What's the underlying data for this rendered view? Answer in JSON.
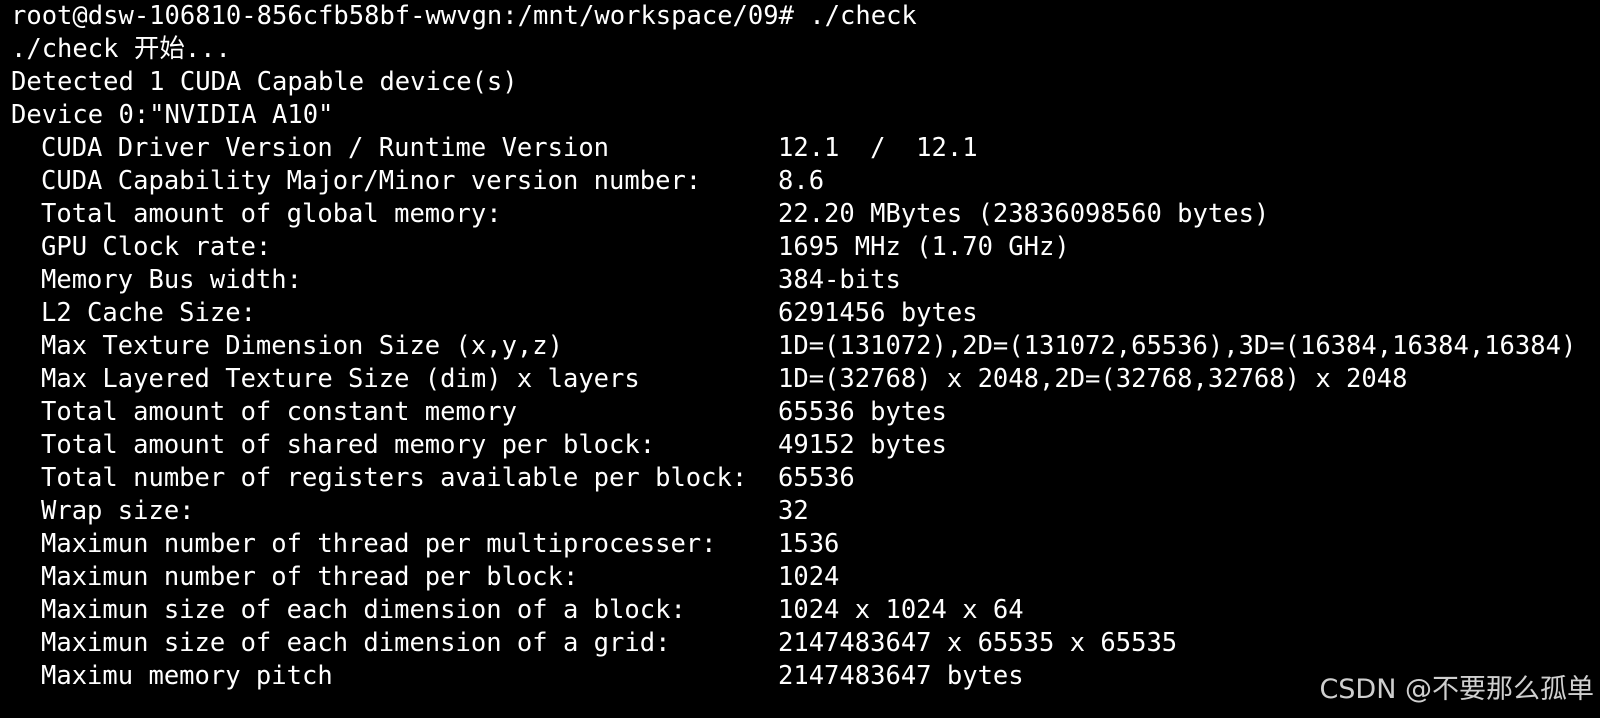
{
  "terminal": {
    "prompt_line": "root@dsw-106810-856cfb58bf-wwvgn:/mnt/workspace/09# ./check",
    "start_line": "./check 开始...",
    "detected_line": "Detected 1 CUDA Capable device(s)",
    "device_line": "Device 0:\"NVIDIA A10\"",
    "properties": [
      {
        "label": "CUDA Driver Version / Runtime Version",
        "value": "12.1  /  12.1"
      },
      {
        "label": "CUDA Capability Major/Minor version number:",
        "value": "8.6"
      },
      {
        "label": "Total amount of global memory:",
        "value": "22.20 MBytes (23836098560 bytes)"
      },
      {
        "label": "GPU Clock rate:",
        "value": "1695 MHz (1.70 GHz)"
      },
      {
        "label": "Memory Bus width:",
        "value": "384-bits"
      },
      {
        "label": "L2 Cache Size:",
        "value": "6291456 bytes"
      },
      {
        "label": "Max Texture Dimension Size (x,y,z)",
        "value": "1D=(131072),2D=(131072,65536),3D=(16384,16384,16384)"
      },
      {
        "label": "Max Layered Texture Size (dim) x layers",
        "value": "1D=(32768) x 2048,2D=(32768,32768) x 2048"
      },
      {
        "label": "Total amount of constant memory",
        "value": "65536 bytes"
      },
      {
        "label": "Total amount of shared memory per block:",
        "value": "49152 bytes"
      },
      {
        "label": "Total number of registers available per block:",
        "value": "65536"
      },
      {
        "label": "Wrap size:",
        "value": "32"
      },
      {
        "label": "Maximun number of thread per multiprocesser:",
        "value": "1536"
      },
      {
        "label": "Maximun number of thread per block:",
        "value": "1024"
      },
      {
        "label": "Maximun size of each dimension of a block:",
        "value": "1024 x 1024 x 64"
      },
      {
        "label": "Maximun size of each dimension of a grid:",
        "value": "2147483647 x 65535 x 65535"
      },
      {
        "label": "Maximu memory pitch",
        "value": "2147483647 bytes"
      }
    ]
  },
  "watermark": "CSDN @不要那么孤单",
  "colors": {
    "background": "#000000",
    "foreground": "#ffffff",
    "watermark": "#cfcfcf"
  }
}
